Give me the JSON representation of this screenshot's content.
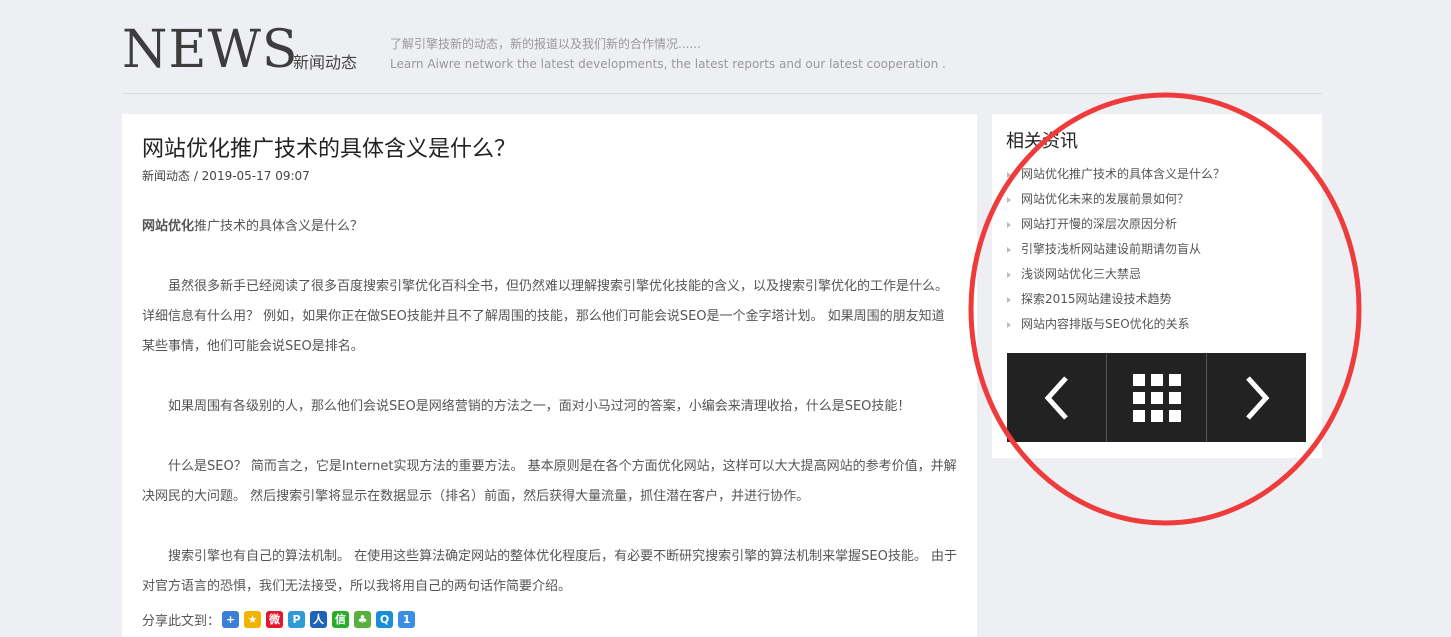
{
  "header": {
    "title_en": "NEWS",
    "title_cn": "新闻动态",
    "desc_cn": "了解引擎技新的动态，新的报道以及我们新的合作情况......",
    "desc_en": "Learn Aiwre network the latest developments, the latest reports and our latest cooperation ."
  },
  "article": {
    "title": "网站优化推广技术的具体含义是什么？",
    "meta": "新闻动态 / 2019-05-17 09:07",
    "lead_bold": "网站优化",
    "lead_rest": "推广技术的具体含义是什么？",
    "paragraphs": [
      "虽然很多新手已经阅读了很多百度搜索引擎优化百科全书，但仍然难以理解搜索引擎优化技能的含义，以及搜索引擎优化的工作是什么。 详细信息有什么用？ 例如，如果你正在做SEO技能并且不了解周围的技能，那么他们可能会说SEO是一个金字塔计划。 如果周围的朋友知道某些事情，他们可能会说SEO是排名。",
      "如果周围有各级别的人，那么他们会说SEO是网络营销的方法之一，面对小马过河的答案，小编会来清理收拾，什么是SEO技能！",
      "什么是SEO？ 简而言之，它是Internet实现方法的重要方法。 基本原则是在各个方面优化网站，这样可以大大提高网站的参考价值，并解决网民的大问题。 然后搜索引擎将显示在数据显示（排名）前面，然后获得大量流量，抓住潜在客户，并进行协作。",
      "搜索引擎也有自己的算法机制。 在使用这些算法确定网站的整体优化程度后，有必要不断研究搜索引擎的算法机制来掌握SEO技能。 由于对官方语言的恐惧，我们无法接受，所以我将用自己的两句话作简要介绍。"
    ],
    "share_label": "分享此文到："
  },
  "share_icons": [
    {
      "name": "more-share-icon",
      "glyph": "+",
      "color": "#3b7fd6"
    },
    {
      "name": "qzone-icon",
      "glyph": "★",
      "color": "#f0b400"
    },
    {
      "name": "weibo-icon",
      "glyph": "微",
      "color": "#e6162d"
    },
    {
      "name": "tencent-weibo-icon",
      "glyph": "P",
      "color": "#2e9bd6"
    },
    {
      "name": "renren-icon",
      "glyph": "人",
      "color": "#1f63b6"
    },
    {
      "name": "wechat-icon",
      "glyph": "信",
      "color": "#2aae2a"
    },
    {
      "name": "kaixin-icon",
      "glyph": "♣",
      "color": "#59b13d"
    },
    {
      "name": "qq-icon",
      "glyph": "Q",
      "color": "#1a8fd9"
    },
    {
      "name": "one-icon",
      "glyph": "1",
      "color": "#3a8ee6"
    }
  ],
  "sidebar": {
    "title": "相关资讯",
    "items": [
      "网站优化推广技术的具体含义是什么？",
      "网站优化未来的发展前景如何？",
      "网站打开慢的深层次原因分析",
      "引擎技浅析网站建设前期请勿盲从",
      "浅谈网站优化三大禁忌",
      "探索2015网站建设技术趋势",
      "网站内容排版与SEO优化的关系"
    ]
  },
  "colors": {
    "background": "#eeeff3",
    "pager_bg": "#222222",
    "annotation": "#ee3b3b"
  }
}
